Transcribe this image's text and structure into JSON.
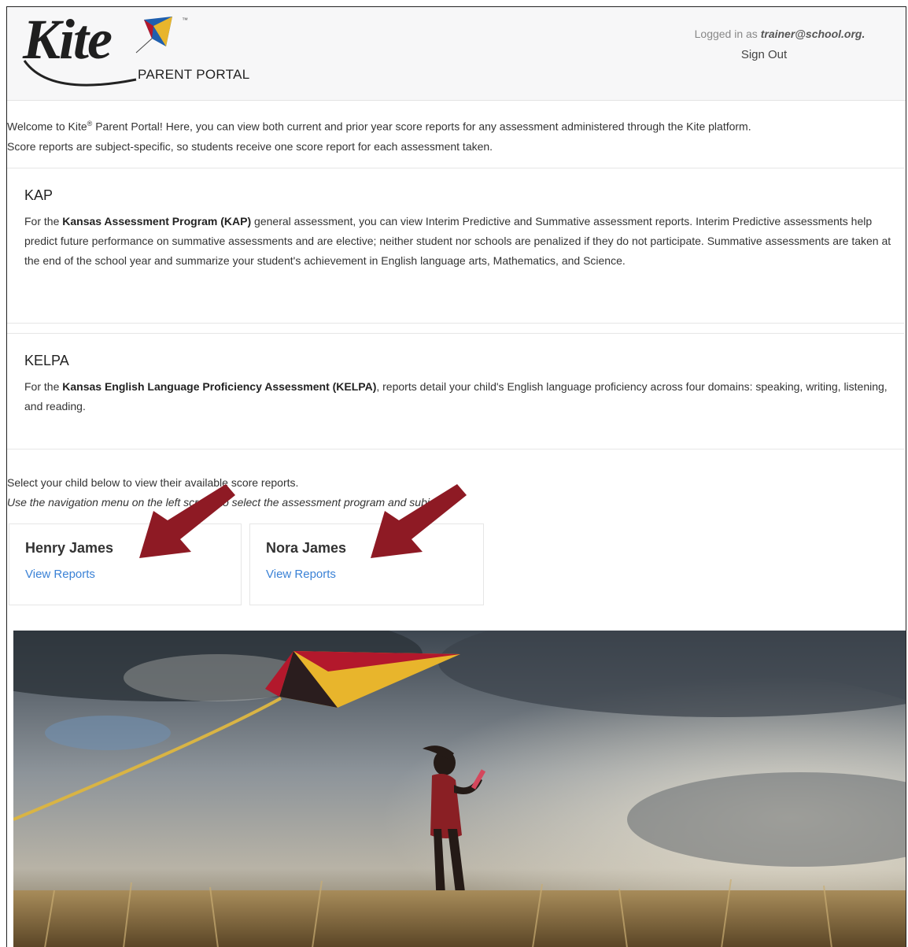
{
  "header": {
    "logo": {
      "word": "Kite",
      "subtitle": "PARENT PORTAL",
      "tm": "™"
    },
    "logged_in_prefix": "Logged in as",
    "user_email": "trainer@school.org.",
    "sign_out_label": "Sign Out"
  },
  "intro": {
    "part1": "Welcome to Kite",
    "reg": "®",
    "part2": " Parent Portal! Here, you can view both current and prior year score reports for any assessment administered through the Kite platform.",
    "line2": "Score reports are subject-specific, so students receive one score report for each assessment taken."
  },
  "kap": {
    "title": "KAP",
    "text_pre": "For the ",
    "bold": "Kansas Assessment Program (KAP)",
    "text_post": " general assessment, you can view Interim Predictive and Summative assessment reports. Interim Predictive assessments help predict future performance on summative assessments and are elective; neither student nor schools are penalized if they do not participate. Summative assessments are taken at the end of the school year and summarize your student's achievement in English language arts, Mathematics, and Science."
  },
  "kelpa": {
    "title": "KELPA",
    "text_pre": "For the ",
    "bold": "Kansas English Language Proficiency Assessment (KELPA)",
    "text_post": ", reports detail your child's English language proficiency across four domains: speaking, writing, listening, and reading."
  },
  "select": {
    "line1": "Select your child below to view their available score reports.",
    "line2": "Use the navigation menu on the left screen to select the assessment program and subject."
  },
  "children": [
    {
      "name": "Henry James",
      "link": "View Reports"
    },
    {
      "name": "Nora James",
      "link": "View Reports"
    }
  ],
  "colors": {
    "link": "#3b82d6",
    "arrow": "#8e1a24",
    "header_bg": "#f7f7f8",
    "kite_yellow": "#e8b52c",
    "kite_red": "#b3182c"
  }
}
